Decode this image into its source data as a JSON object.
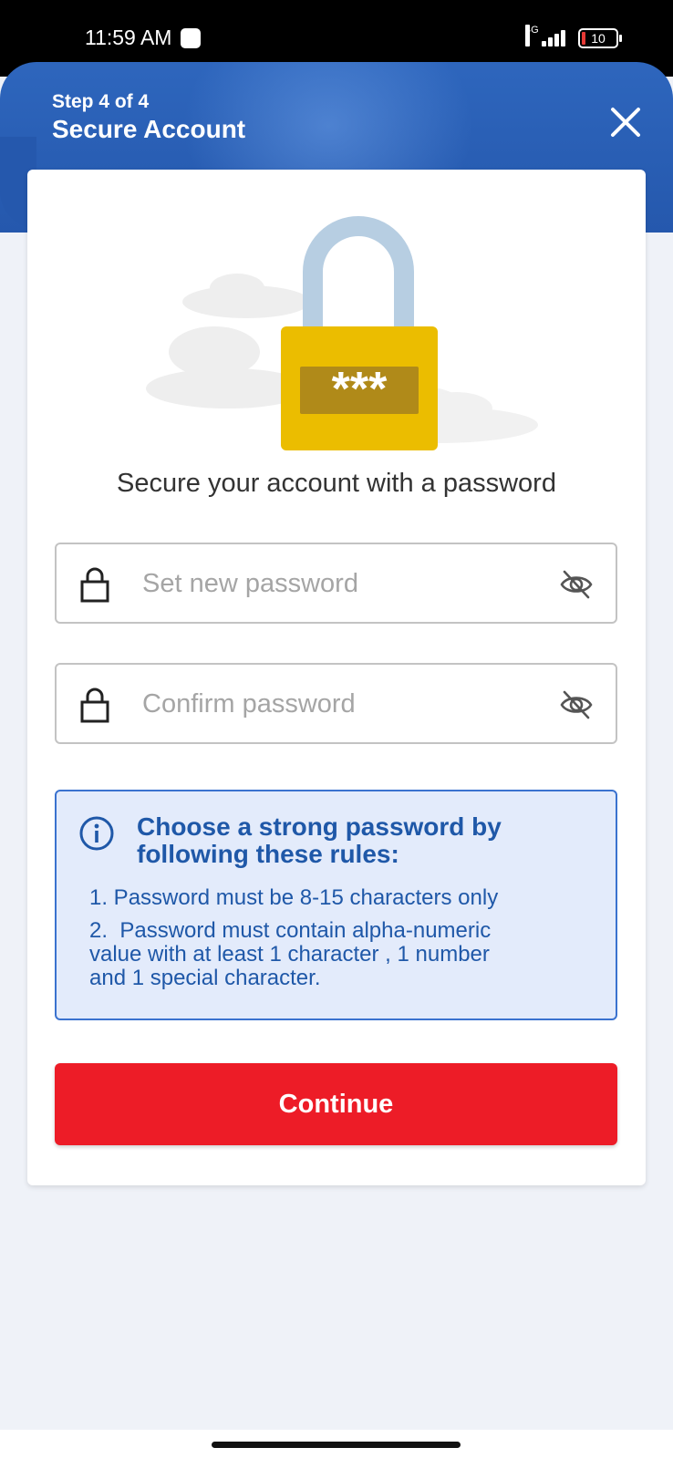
{
  "status_bar": {
    "time": "11:59 AM",
    "network": "4G",
    "battery": "10"
  },
  "header": {
    "step": "Step 4 of 4",
    "title": "Secure Account",
    "close_icon": "close-icon"
  },
  "illustration": {
    "mask_text": "***",
    "icon": "padlock-illustration"
  },
  "subtitle": "Secure your account with a password",
  "fields": {
    "new_password": {
      "placeholder": "Set new password",
      "value": ""
    },
    "confirm_password": {
      "placeholder": "Confirm password",
      "value": ""
    }
  },
  "info": {
    "heading": "Choose a strong password by following these rules:",
    "rules": [
      "1. Password must be 8-15 characters only",
      "2.  Password must contain alpha-numeric\nvalue with at least 1 character , 1 number\nand 1 special character."
    ]
  },
  "continue_label": "Continue",
  "colors": {
    "header_blue": "#2558ad",
    "primary_red": "#ed1c27",
    "info_bg": "#e3ebfb",
    "info_text": "#1f58a8",
    "lock_gold": "#ebbd00"
  }
}
